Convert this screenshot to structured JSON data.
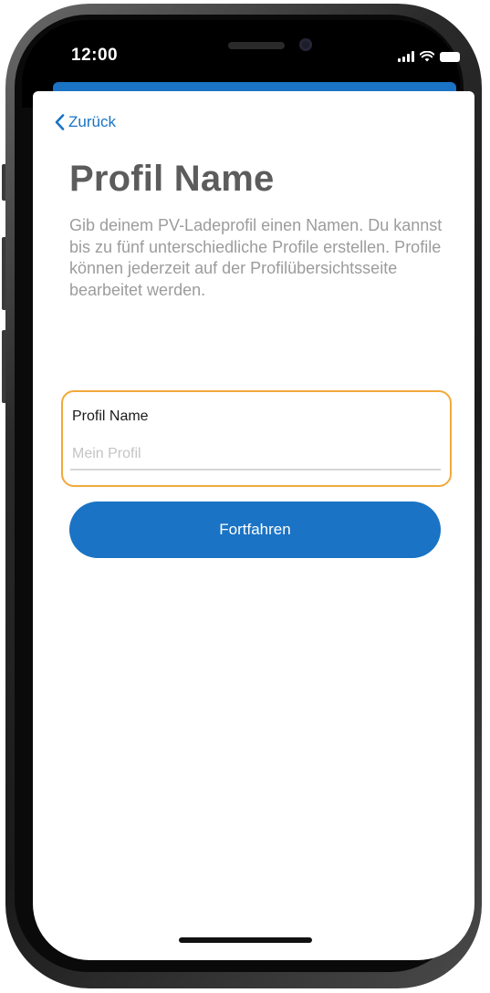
{
  "status_bar": {
    "time": "12:00"
  },
  "nav": {
    "back_label": "Zurück"
  },
  "page": {
    "title": "Profil Name",
    "description": "Gib deinem PV-Ladeprofil einen Namen. Du kannst bis zu fünf unterschiedliche Profile erstellen. Profile können jederzeit auf der Profilübersichtsseite bearbeitet werden."
  },
  "form": {
    "name_label": "Profil Name",
    "name_placeholder": "Mein Profil",
    "name_value": ""
  },
  "actions": {
    "continue_label": "Fortfahren"
  },
  "colors": {
    "accent": "#1a73c4",
    "focus_border": "#f2a93b"
  },
  "icons": {
    "back": "chevron-left-icon",
    "signal": "cellular-signal-icon",
    "wifi": "wifi-icon",
    "battery": "battery-icon"
  }
}
